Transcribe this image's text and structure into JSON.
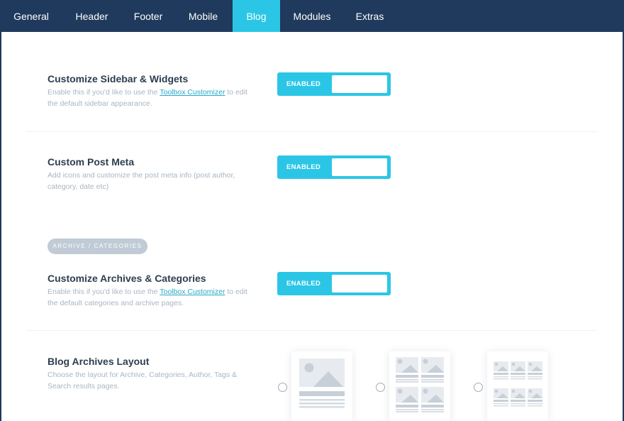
{
  "nav": {
    "tabs": [
      {
        "label": "General"
      },
      {
        "label": "Header"
      },
      {
        "label": "Footer"
      },
      {
        "label": "Mobile"
      },
      {
        "label": "Blog",
        "active": true
      },
      {
        "label": "Modules"
      },
      {
        "label": "Extras"
      }
    ]
  },
  "settings": {
    "sidebar": {
      "title": "Customize Sidebar & Widgets",
      "desc_pre": "Enable this if you'd like to use the ",
      "link": "Toolbox Customizer",
      "desc_post": " to edit the default sidebar appearance.",
      "toggle": "ENABLED"
    },
    "post_meta": {
      "title": "Custom Post Meta",
      "desc": "Add icons and customize the post meta info (post author, category, date etc)",
      "toggle": "ENABLED"
    },
    "section_label": "ARCHIVE / CATEGORIES",
    "archives": {
      "title": "Customize Archives & Categories",
      "desc_pre": "Enable this if you'd like to use the ",
      "link": "Toolbox Customizer",
      "desc_post": " to edit the default categories and archive pages.",
      "toggle": "ENABLED"
    },
    "layout": {
      "title": "Blog Archives Layout",
      "desc": "Choose the layout for Archive, Categories, Author, Tags & Search results pages.",
      "options": [
        {
          "icon": "single-column-layout-icon"
        },
        {
          "icon": "two-column-grid-layout-icon"
        },
        {
          "icon": "three-column-grid-layout-icon"
        }
      ]
    }
  },
  "colors": {
    "nav_bg": "#1f3a5c",
    "accent": "#2bc6e6",
    "title": "#2c3e50",
    "muted": "#a9b6c4",
    "pill": "#c0cbd5"
  }
}
